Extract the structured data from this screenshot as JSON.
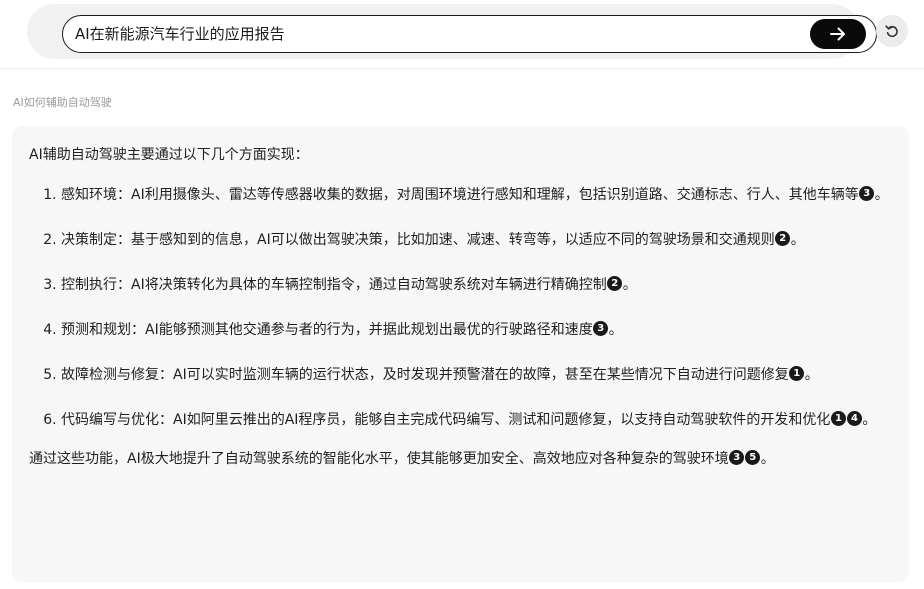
{
  "search": {
    "value": "AI在新能源汽车行业的应用报告",
    "submit_icon": "arrow-right-icon",
    "undo_icon": "undo-icon"
  },
  "query_label": "AI如何辅助自动驾驶",
  "answer": {
    "intro": "AI辅助自动驾驶主要通过以下几个方面实现：",
    "points": [
      {
        "text": "感知环境：AI利用摄像头、雷达等传感器收集的数据，对周围环境进行感知和理解，包括识别道路、交通标志、行人、其他车辆等",
        "citations": [
          "3"
        ],
        "end": "。"
      },
      {
        "text": "决策制定：基于感知到的信息，AI可以做出驾驶决策，比如加速、减速、转弯等，以适应不同的驾驶场景和交通规则",
        "citations": [
          "2"
        ],
        "end": "。"
      },
      {
        "text": "控制执行：AI将决策转化为具体的车辆控制指令，通过自动驾驶系统对车辆进行精确控制",
        "citations": [
          "2"
        ],
        "end": "。"
      },
      {
        "text": "预测和规划：AI能够预测其他交通参与者的行为，并据此规划出最优的行驶路径和速度",
        "citations": [
          "3"
        ],
        "end": "。"
      },
      {
        "text": "故障检测与修复：AI可以实时监测车辆的运行状态，及时发现并预警潜在的故障，甚至在某些情况下自动进行问题修复",
        "citations": [
          "1"
        ],
        "end": "。"
      },
      {
        "text": "代码编写与优化：AI如阿里云推出的AI程序员，能够自主完成代码编写、测试和问题修复，以支持自动驾驶软件的开发和优化",
        "citations": [
          "1",
          "4"
        ],
        "end": "。"
      }
    ],
    "outro": {
      "text": "通过这些功能，AI极大地提升了自动驾驶系统的智能化水平，使其能够更加安全、高效地应对各种复杂的驾驶环境",
      "citations": [
        "3",
        "5"
      ],
      "end": "。"
    }
  },
  "colors": {
    "card_background": "#f7f7f7",
    "citation_badge": "#1a1a1a",
    "submit_button": "#0a0a0a"
  }
}
